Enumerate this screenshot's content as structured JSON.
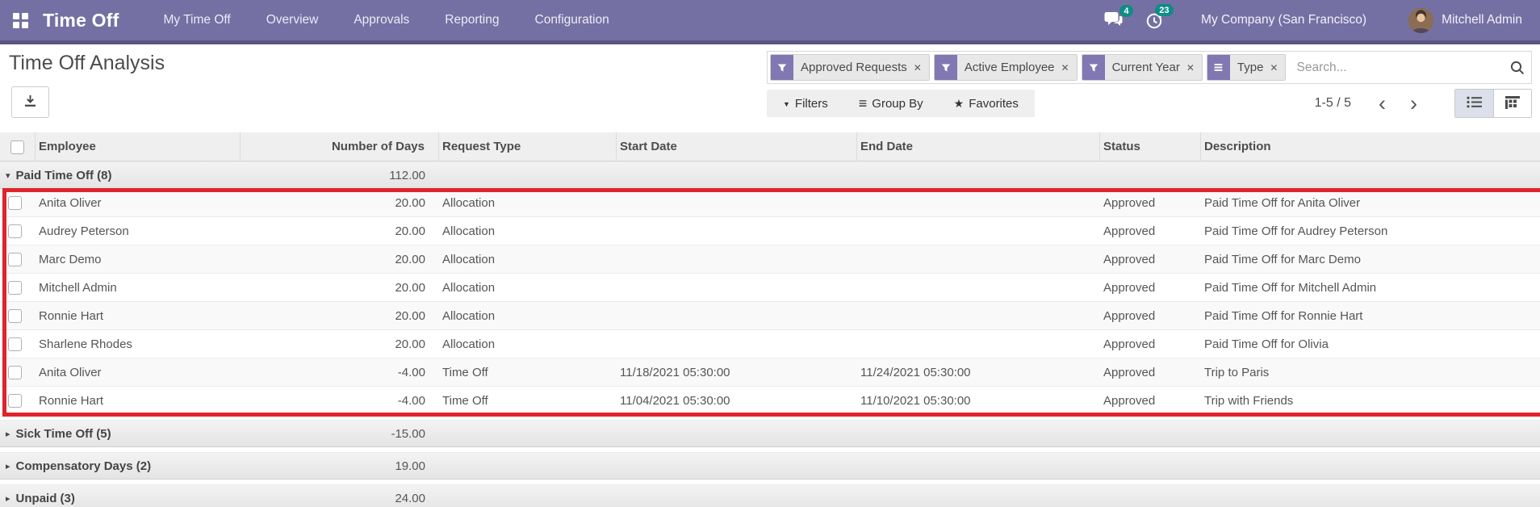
{
  "navbar": {
    "app_name": "Time Off",
    "menu": [
      "My Time Off",
      "Overview",
      "Approvals",
      "Reporting",
      "Configuration"
    ],
    "messages_badge": "4",
    "activities_badge": "23",
    "company": "My Company (San Francisco)",
    "user": "Mitchell Admin"
  },
  "page": {
    "title": "Time Off Analysis"
  },
  "search": {
    "facets": [
      {
        "label": "Approved Requests",
        "icon": "filter-icon"
      },
      {
        "label": "Active Employee",
        "icon": "filter-icon"
      },
      {
        "label": "Current Year",
        "icon": "filter-icon"
      },
      {
        "label": "Type",
        "icon": "group-by-icon"
      }
    ],
    "placeholder": "Search..."
  },
  "controls": {
    "filters": "Filters",
    "group_by": "Group By",
    "favorites": "Favorites"
  },
  "pager": {
    "range": "1-5 / 5"
  },
  "icons": {
    "facet_remove": "✕",
    "filters_caret": "▼",
    "group_by_bars": "≡",
    "favorites_star": "★",
    "pager_prev": "‹",
    "pager_next": "›",
    "group_expanded": "▾",
    "group_collapsed": "▸"
  },
  "table": {
    "columns": [
      "Employee",
      "Number of Days",
      "Request Type",
      "Start Date",
      "End Date",
      "Status",
      "Description"
    ],
    "groups": [
      {
        "label": "Paid Time Off (8)",
        "total": "112.00",
        "expanded": true,
        "rows": [
          {
            "employee": "Anita Oliver",
            "days": "20.00",
            "type": "Allocation",
            "start": "",
            "end": "",
            "status": "Approved",
            "description": "Paid Time Off for Anita Oliver"
          },
          {
            "employee": "Audrey Peterson",
            "days": "20.00",
            "type": "Allocation",
            "start": "",
            "end": "",
            "status": "Approved",
            "description": "Paid Time Off for Audrey Peterson"
          },
          {
            "employee": "Marc Demo",
            "days": "20.00",
            "type": "Allocation",
            "start": "",
            "end": "",
            "status": "Approved",
            "description": "Paid Time Off for Marc Demo"
          },
          {
            "employee": "Mitchell Admin",
            "days": "20.00",
            "type": "Allocation",
            "start": "",
            "end": "",
            "status": "Approved",
            "description": "Paid Time Off for Mitchell Admin"
          },
          {
            "employee": "Ronnie Hart",
            "days": "20.00",
            "type": "Allocation",
            "start": "",
            "end": "",
            "status": "Approved",
            "description": "Paid Time Off for Ronnie Hart"
          },
          {
            "employee": "Sharlene Rhodes",
            "days": "20.00",
            "type": "Allocation",
            "start": "",
            "end": "",
            "status": "Approved",
            "description": "Paid Time Off for Olivia"
          },
          {
            "employee": "Anita Oliver",
            "days": "-4.00",
            "type": "Time Off",
            "start": "11/18/2021 05:30:00",
            "end": "11/24/2021 05:30:00",
            "status": "Approved",
            "description": "Trip to Paris"
          },
          {
            "employee": "Ronnie Hart",
            "days": "-4.00",
            "type": "Time Off",
            "start": "11/04/2021 05:30:00",
            "end": "11/10/2021 05:30:00",
            "status": "Approved",
            "description": "Trip with Friends"
          }
        ]
      },
      {
        "label": "Sick Time Off (5)",
        "total": "-15.00",
        "expanded": false,
        "rows": []
      },
      {
        "label": "Compensatory Days (2)",
        "total": "19.00",
        "expanded": false,
        "rows": []
      },
      {
        "label": "Unpaid (3)",
        "total": "24.00",
        "expanded": false,
        "rows": []
      }
    ]
  },
  "colors": {
    "navbar_bg": "#7570a3",
    "navbar_border": "#5b5681",
    "badge_teal": "#0e8c85",
    "facet_purple": "#8177b2",
    "active_view_bg": "#dbe0ea",
    "annotation_red": "#e0242b"
  }
}
